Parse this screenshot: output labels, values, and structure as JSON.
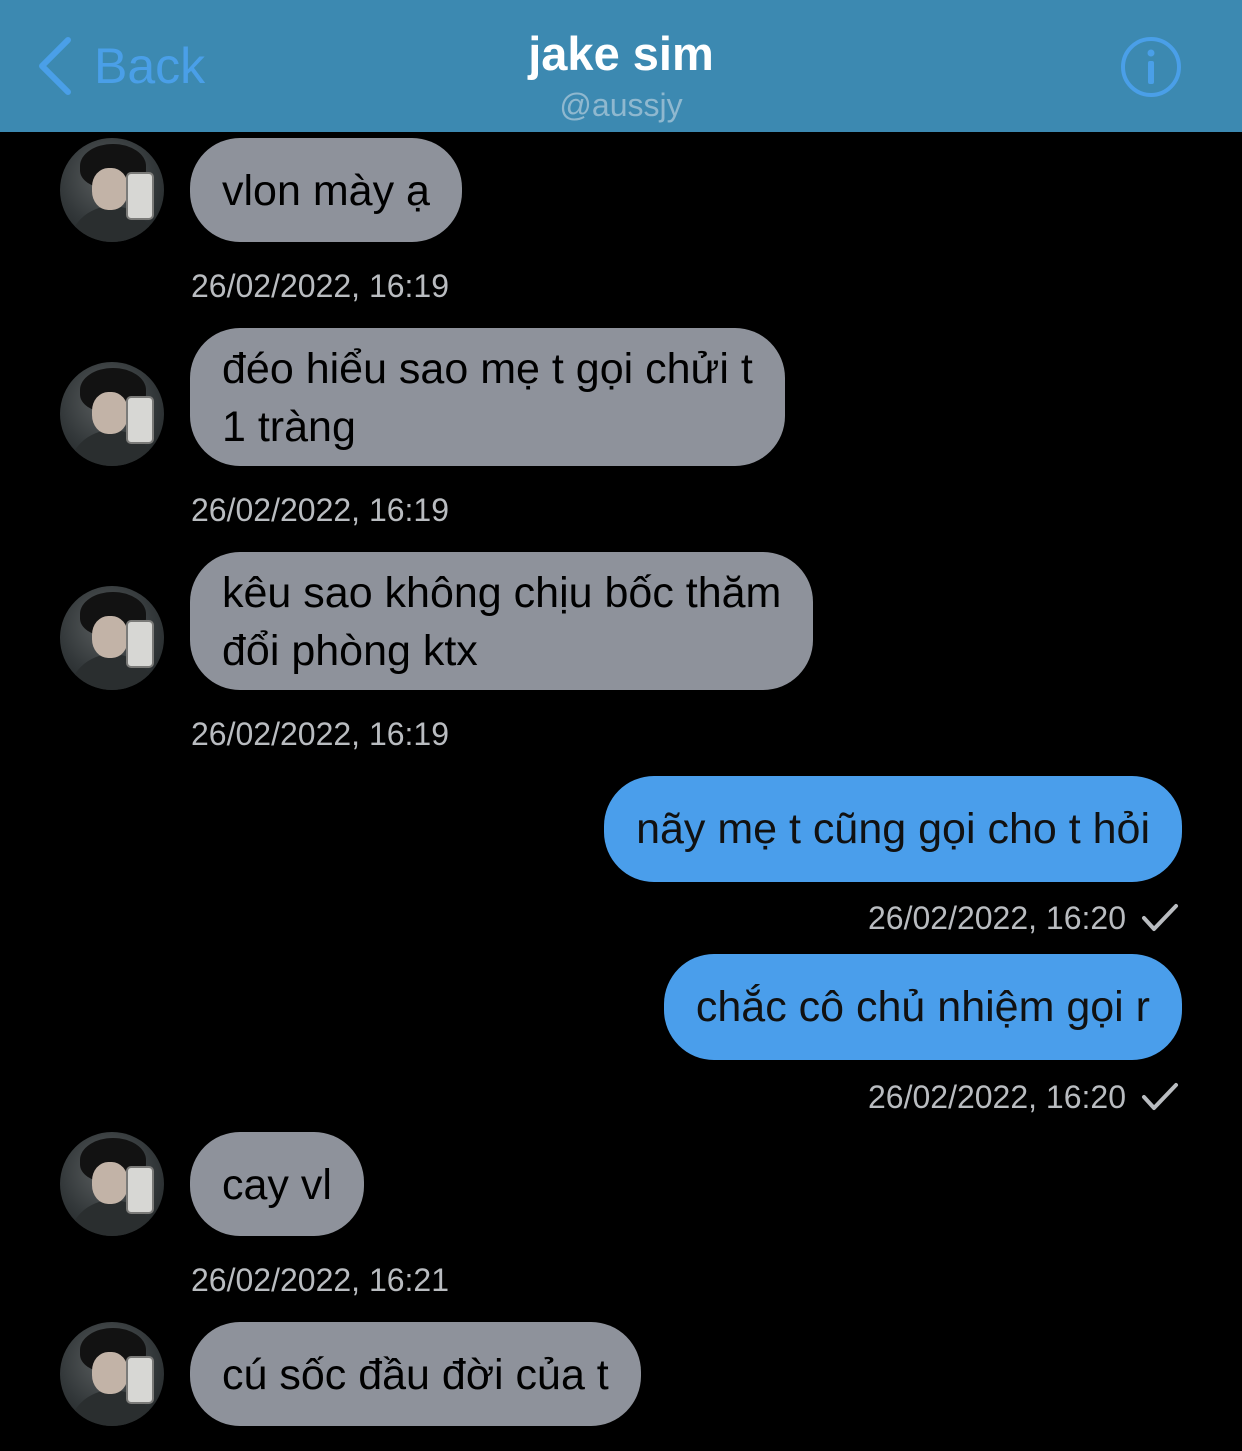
{
  "header": {
    "back_label": "Back",
    "title": "jake sim",
    "subtitle": "@aussjy",
    "back_icon": "chevron-left-icon",
    "info_icon": "info-circle-icon"
  },
  "colors": {
    "header_bg": "#3c89b1",
    "accent": "#4a9fe8",
    "incoming_bubble": "#8e929b",
    "outgoing_bubble": "#4a9eeb",
    "background": "#000000"
  },
  "messages": [
    {
      "direction": "in",
      "text": "vlon mày ạ",
      "timestamp": "26/02/2022, 16:19"
    },
    {
      "direction": "in",
      "text": "đéo hiểu sao mẹ t gọi chửi t\n1 tràng",
      "timestamp": "26/02/2022, 16:19"
    },
    {
      "direction": "in",
      "text": "kêu sao không chịu bốc thăm\nđổi phòng ktx",
      "timestamp": "26/02/2022, 16:19"
    },
    {
      "direction": "out",
      "text": "nãy mẹ t cũng gọi cho t hỏi",
      "timestamp": "26/02/2022, 16:20",
      "status_icon": "checkmark-icon"
    },
    {
      "direction": "out",
      "text": "chắc cô chủ nhiệm gọi r",
      "timestamp": "26/02/2022, 16:20",
      "status_icon": "checkmark-icon"
    },
    {
      "direction": "in",
      "text": "cay vl",
      "timestamp": "26/02/2022, 16:21"
    },
    {
      "direction": "in",
      "text": "cú sốc đầu đời của t"
    }
  ]
}
